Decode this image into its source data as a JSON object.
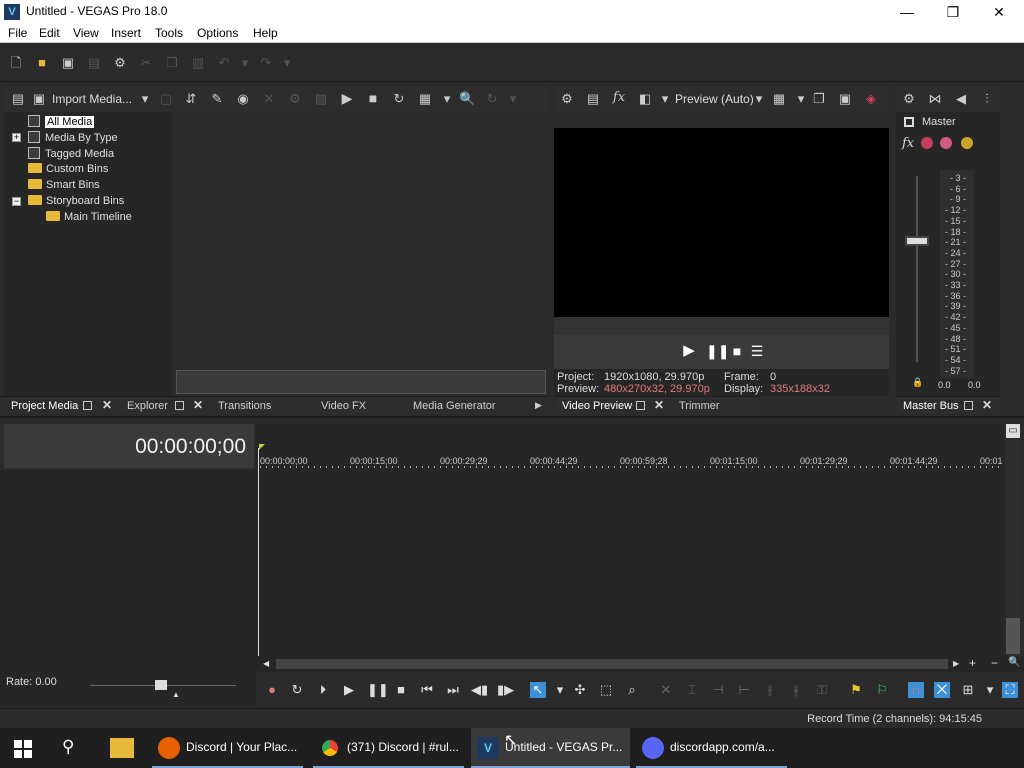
{
  "window": {
    "title": "Untitled - VEGAS Pro 18.0",
    "logo_letter": "V",
    "minimize": "—",
    "maximize": "❐",
    "close": "✕"
  },
  "menu": [
    "File",
    "Edit",
    "View",
    "Insert",
    "Tools",
    "Options",
    "Help"
  ],
  "project_media": {
    "import_label": "Import Media...",
    "tree": [
      {
        "label": "All Media",
        "icon": "media-icon",
        "selected": true
      },
      {
        "label": "Media By Type",
        "icon": "media-icon",
        "expander": "+"
      },
      {
        "label": "Tagged Media",
        "icon": "media-icon"
      },
      {
        "label": "Custom Bins",
        "icon": "folder-icon"
      },
      {
        "label": "Smart Bins",
        "icon": "folder-icon"
      },
      {
        "label": "Storyboard Bins",
        "icon": "folder-icon",
        "expander": "−"
      },
      {
        "label": "Main Timeline",
        "icon": "folder-icon"
      }
    ],
    "tabs": [
      "Project Media",
      "Explorer",
      "Transitions",
      "Video FX",
      "Media Generator"
    ]
  },
  "preview": {
    "mode": "Preview (Auto)",
    "project_label": "Project:",
    "project_value": "1920x1080, 29.970p",
    "frame_label": "Frame:",
    "frame_value": "0",
    "preview_label": "Preview:",
    "preview_value": "480x270x32, 29.970p",
    "display_label": "Display:",
    "display_value": "335x188x32",
    "tabs": [
      "Video Preview",
      "Trimmer"
    ]
  },
  "master": {
    "label": "Master",
    "scale": [
      "3",
      "6",
      "9",
      "12",
      "15",
      "18",
      "21",
      "24",
      "27",
      "30",
      "33",
      "36",
      "39",
      "42",
      "45",
      "48",
      "51",
      "54",
      "57"
    ],
    "left_level": "0.0",
    "right_level": "0.0",
    "tab": "Master Bus"
  },
  "timeline": {
    "timecode": "00:00:00;00",
    "ruler": [
      "00:00:00;00",
      "00:00:15;00",
      "00:00:29;29",
      "00:00:44;29",
      "00:00:59;28",
      "00:01:15;00",
      "00:01:29;29",
      "00:01:44;29",
      "00:01"
    ],
    "rate": "Rate: 0.00"
  },
  "status": {
    "record_time": "Record Time (2 channels): 94:15:45"
  },
  "taskbar": {
    "items": [
      {
        "label": "Discord | Your Plac...",
        "icon_color": "#e66000"
      },
      {
        "label": "(371) Discord | #rul...",
        "icon_color": "#4285f4"
      },
      {
        "label": "Untitled - VEGAS Pr...",
        "icon_color": "#1e3a5f"
      },
      {
        "label": "discordapp.com/a...",
        "icon_color": "#5865f2"
      }
    ]
  },
  "colors": {
    "accent_blue": "#3d8fd6",
    "highlight_red": "#e07a7a",
    "folder_yellow": "#e8b83a"
  }
}
